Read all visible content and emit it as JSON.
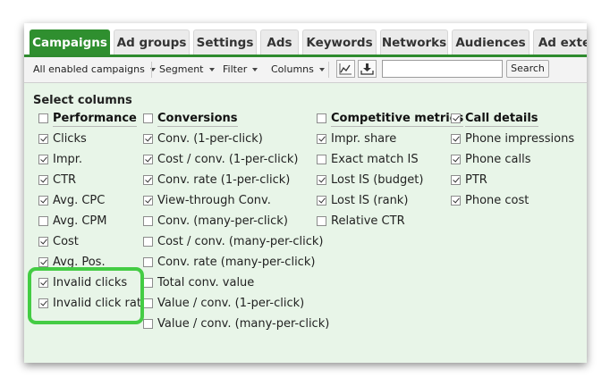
{
  "tabs": [
    "Campaigns",
    "Ad groups",
    "Settings",
    "Ads",
    "Keywords",
    "Networks",
    "Audiences",
    "Ad exte"
  ],
  "toolbar": {
    "filter_select": "All enabled campaigns",
    "segment": "Segment",
    "filter": "Filter",
    "columns": "Columns",
    "search_value": "",
    "search_button": "Search"
  },
  "section_title": "Select columns",
  "columns": [
    {
      "header": "Performance",
      "header_checked": false,
      "items": [
        {
          "label": "Clicks",
          "checked": true
        },
        {
          "label": "Impr.",
          "checked": true
        },
        {
          "label": "CTR",
          "checked": true
        },
        {
          "label": "Avg. CPC",
          "checked": true
        },
        {
          "label": "Avg. CPM",
          "checked": false
        },
        {
          "label": "Cost",
          "checked": true
        },
        {
          "label": "Avg. Pos.",
          "checked": true
        },
        {
          "label": "Invalid clicks",
          "checked": true
        },
        {
          "label": "Invalid click rate",
          "checked": true
        }
      ]
    },
    {
      "header": "Conversions",
      "header_checked": false,
      "items": [
        {
          "label": "Conv. (1-per-click)",
          "checked": true
        },
        {
          "label": "Cost / conv. (1-per-click)",
          "checked": true
        },
        {
          "label": "Conv. rate (1-per-click)",
          "checked": true
        },
        {
          "label": "View-through Conv.",
          "checked": true
        },
        {
          "label": "Conv. (many-per-click)",
          "checked": false
        },
        {
          "label": "Cost / conv. (many-per-click)",
          "checked": false
        },
        {
          "label": "Conv. rate (many-per-click)",
          "checked": false
        },
        {
          "label": "Total conv. value",
          "checked": false
        },
        {
          "label": "Value / conv. (1-per-click)",
          "checked": false
        },
        {
          "label": "Value / conv. (many-per-click)",
          "checked": false
        }
      ]
    },
    {
      "header": "Competitive metrics",
      "header_checked": false,
      "items": [
        {
          "label": "Impr. share",
          "checked": true
        },
        {
          "label": "Exact match IS",
          "checked": false
        },
        {
          "label": "Lost IS (budget)",
          "checked": true
        },
        {
          "label": "Lost IS (rank)",
          "checked": true
        },
        {
          "label": "Relative CTR",
          "checked": false
        }
      ]
    },
    {
      "header": "Call details",
      "header_checked": true,
      "items": [
        {
          "label": "Phone impressions",
          "checked": true
        },
        {
          "label": "Phone calls",
          "checked": true
        },
        {
          "label": "PTR",
          "checked": true
        },
        {
          "label": "Phone cost",
          "checked": true
        }
      ]
    }
  ],
  "icons": {
    "chart": "line-chart-icon",
    "download": "download-icon"
  },
  "colors": {
    "accent": "#2f8f2f",
    "panel_bg": "#e8f5e8",
    "highlight": "#44cc44"
  }
}
